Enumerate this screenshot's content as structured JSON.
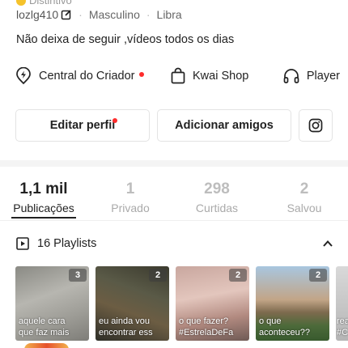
{
  "profile": {
    "badge_partial": "Distintivo",
    "handle": "lozlg410",
    "gender": "Masculino",
    "sign": "Libra",
    "bio": "Não deixa de seguir ,vídeos todos os dias"
  },
  "links": {
    "creator_center": "Central do Criador",
    "kwai_shop": "Kwai Shop",
    "player": "Player"
  },
  "buttons": {
    "edit_profile": "Editar perfil",
    "add_friends": "Adicionar amigos"
  },
  "stats": [
    {
      "value": "1,1 mil",
      "label": "Publicações"
    },
    {
      "value": "1",
      "label": "Privado"
    },
    {
      "value": "298",
      "label": "Curtidas"
    },
    {
      "value": "2",
      "label": "Salvou"
    }
  ],
  "playlists": {
    "title": "16 Playlists",
    "items": [
      {
        "count": "3",
        "caption": "aquele cara\nque faz mais"
      },
      {
        "count": "2",
        "caption": "eu ainda vou\nencontrar ess"
      },
      {
        "count": "2",
        "caption": "o que fazer?\n#EstrelaDeFa"
      },
      {
        "count": "2",
        "caption": "o que\naconteceu??"
      },
      {
        "count": "",
        "caption": "rea\n#C"
      }
    ]
  },
  "colors": {
    "accent_red": "#fe2c2c",
    "badge_yellow": "#f5c22b",
    "text_primary": "#222222",
    "text_muted": "#aaaaaa"
  }
}
